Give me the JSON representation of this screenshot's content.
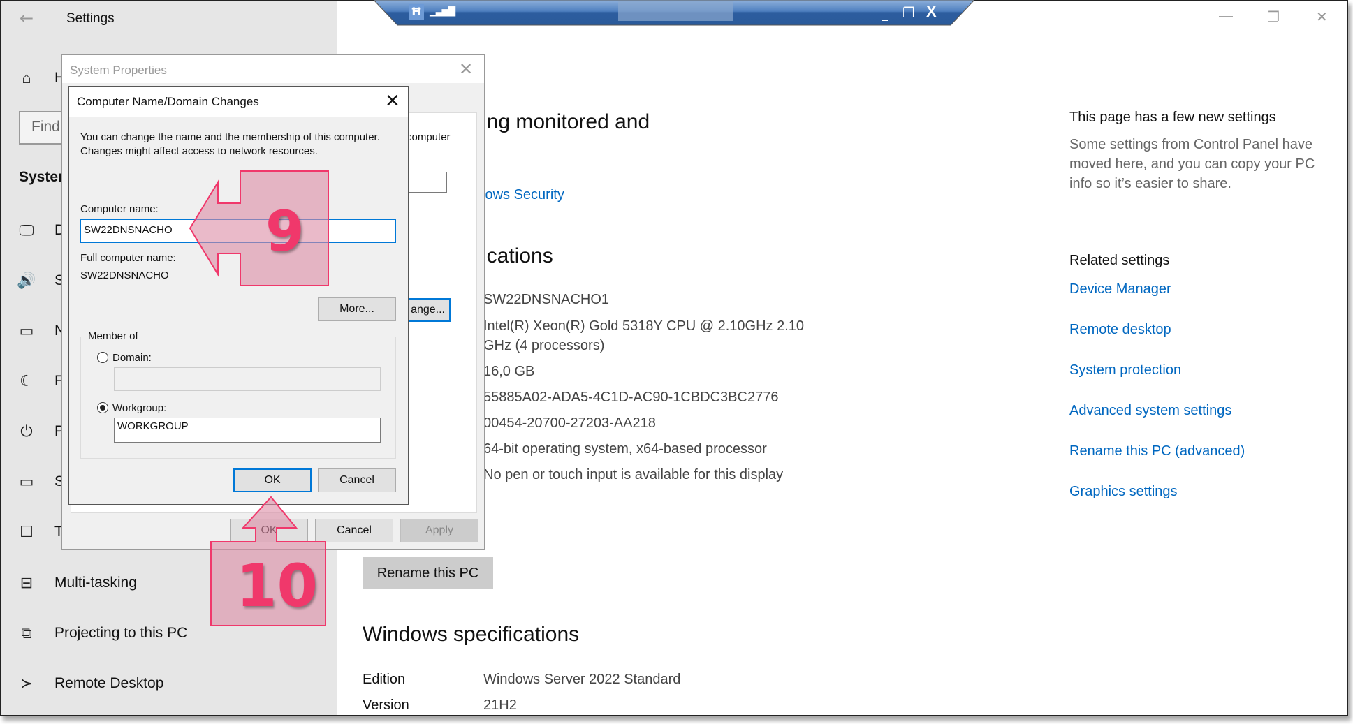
{
  "settings_window": {
    "title": "Settings",
    "back_icon": "back-arrow-icon",
    "controls": {
      "minimize": "—",
      "restore": "❐",
      "close": "✕"
    },
    "sidebar": {
      "home_label": "H",
      "search_placeholder": "Find",
      "section_label": "System",
      "items": [
        {
          "icon": "display-icon",
          "glyph": "🖵",
          "label": "Di"
        },
        {
          "icon": "sound-icon",
          "glyph": "🔊",
          "label": "So"
        },
        {
          "icon": "notifications-icon",
          "glyph": "▭",
          "label": "N"
        },
        {
          "icon": "focus-assist-icon",
          "glyph": "☾",
          "label": "Fo"
        },
        {
          "icon": "power-icon",
          "glyph": "⏻",
          "label": "Po"
        },
        {
          "icon": "storage-icon",
          "glyph": "▭",
          "label": "St"
        },
        {
          "icon": "tablet-icon",
          "glyph": "☐",
          "label": "Ta"
        },
        {
          "icon": "multitasking-icon",
          "glyph": "⊟",
          "label": "Multi-tasking"
        },
        {
          "icon": "projecting-icon",
          "glyph": "⧉",
          "label": "Projecting to this PC"
        },
        {
          "icon": "remote-desktop-icon",
          "glyph": "≻",
          "label": "Remote Desktop"
        }
      ]
    },
    "main": {
      "monitored_heading_partial": "ing monitored and",
      "security_link_partial": "lows Security",
      "device_specs_partial": "ications",
      "device_specs_values": [
        "SW22DNSNACHO1",
        "Intel(R) Xeon(R) Gold 5318Y CPU @ 2.10GHz   2.10",
        "GHz  (4 processors)",
        "16,0 GB",
        "55885A02-ADA5-4C1D-AC90-1CBDC3BC2776",
        "00454-20700-27203-AA218",
        "64-bit operating system, x64-based processor",
        "No pen or touch input is available for this display"
      ],
      "rename_button": "Rename this PC",
      "windows_specs_heading": "Windows specifications",
      "windows_specs": [
        {
          "label": "Edition",
          "value": "Windows Server 2022 Standard"
        },
        {
          "label": "Version",
          "value": "21H2"
        }
      ]
    },
    "right_panel": {
      "new_settings_title": "This page has a few new settings",
      "new_settings_desc": "Some settings from Control Panel have moved here, and you can copy your PC info so it’s easier to share.",
      "related_title": "Related settings",
      "related_links": [
        "Device Manager",
        "Remote desktop",
        "System protection",
        "Advanced system settings",
        "Rename this PC (advanced)",
        "Graphics settings"
      ]
    }
  },
  "remote_toolbar": {
    "pin_icon": "pin-icon",
    "signal_icon": "connection-signal-icon",
    "controls": {
      "minimize": "_",
      "restore": "❐",
      "close": "X"
    }
  },
  "system_properties": {
    "title": "System Properties",
    "partial_text": "computer",
    "change_button_partial": "ange...",
    "buttons": {
      "ok": "OK",
      "cancel": "Cancel",
      "apply": "Apply"
    }
  },
  "computer_name_dialog": {
    "title": "Computer Name/Domain Changes",
    "description": "You can change the name and the membership of this computer. Changes might affect access to network resources.",
    "computer_name_label": "Computer name:",
    "computer_name_value": "SW22DNSNACHO",
    "full_name_label": "Full computer name:",
    "full_name_value": "SW22DNSNACHO",
    "more_button": "More...",
    "member_of_label": "Member of",
    "domain_label": "Domain:",
    "domain_value": "",
    "domain_selected": false,
    "workgroup_label": "Workgroup:",
    "workgroup_value": "WORKGROUP",
    "workgroup_selected": true,
    "ok_button": "OK",
    "cancel_button": "Cancel"
  },
  "annotations": {
    "step9": "9",
    "step10": "10",
    "color": "#f0386b"
  }
}
